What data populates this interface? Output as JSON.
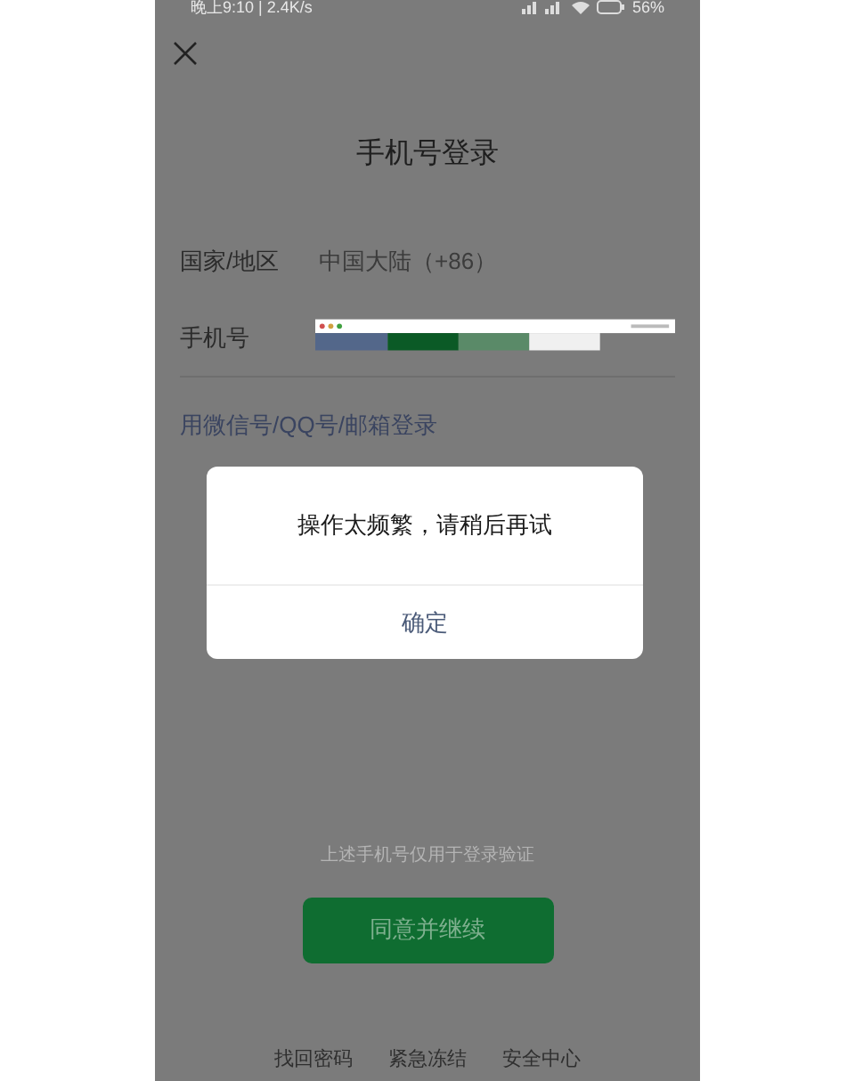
{
  "status_bar": {
    "time": "晚上9:10 | 2.4K/s",
    "battery": "56%"
  },
  "title": "手机号登录",
  "fields": [
    {
      "label": "国家/地区",
      "value": "中国大陆（+86）",
      "kind": "text"
    },
    {
      "label": "手机号",
      "kind": "redacted"
    }
  ],
  "alt_login_link": "用微信号/QQ号/邮箱登录",
  "notice": "上述手机号仅用于登录验证",
  "primary_button": "同意并继续",
  "footer_links": [
    "找回密码",
    "紧急冻结",
    "安全中心"
  ],
  "dialog": {
    "message": "操作太频繁，请稍后再试",
    "button": "确定"
  }
}
